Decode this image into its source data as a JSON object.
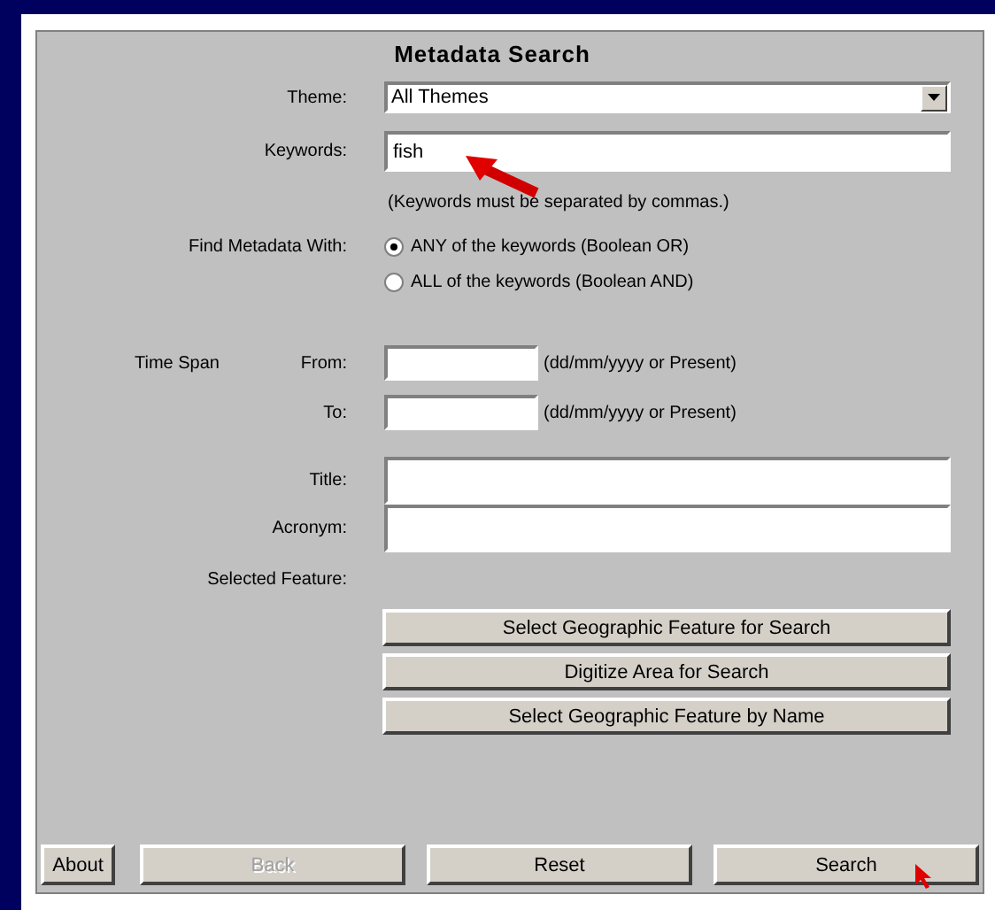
{
  "window": {
    "title": "Metadata Search"
  },
  "themes": {
    "label": "Theme:",
    "value": "All Themes"
  },
  "keywords": {
    "label": "Keywords:",
    "value": "fish",
    "hint": "(Keywords must be separated by commas.)"
  },
  "find_with": {
    "label": "Find Metadata With:",
    "options": [
      {
        "label": "ANY of the keywords (Boolean OR)",
        "selected": true
      },
      {
        "label": "ALL of the keywords (Boolean AND)",
        "selected": false
      }
    ]
  },
  "time_span": {
    "label": "Time Span",
    "rows": [
      {
        "label": "From:",
        "hint": "(dd/mm/yyyy or Present)"
      },
      {
        "label": "To:",
        "hint": "(dd/mm/yyyy or Present)"
      }
    ]
  },
  "text_fields": [
    {
      "label": "Title:"
    },
    {
      "label": "Acronym:"
    }
  ],
  "selected_feature": {
    "label": "Selected Feature:"
  },
  "feature_buttons": [
    "Select Geographic Feature for Search",
    "Digitize Area for Search",
    "Select Geographic Feature by Name"
  ],
  "bottom_buttons": [
    {
      "label": "About",
      "disabled": false,
      "kind": "small"
    },
    {
      "label": "Back",
      "disabled": true,
      "kind": "wide"
    },
    {
      "label": "Reset",
      "disabled": false,
      "kind": "wide"
    },
    {
      "label": "Search",
      "disabled": false,
      "kind": "wide"
    }
  ]
}
